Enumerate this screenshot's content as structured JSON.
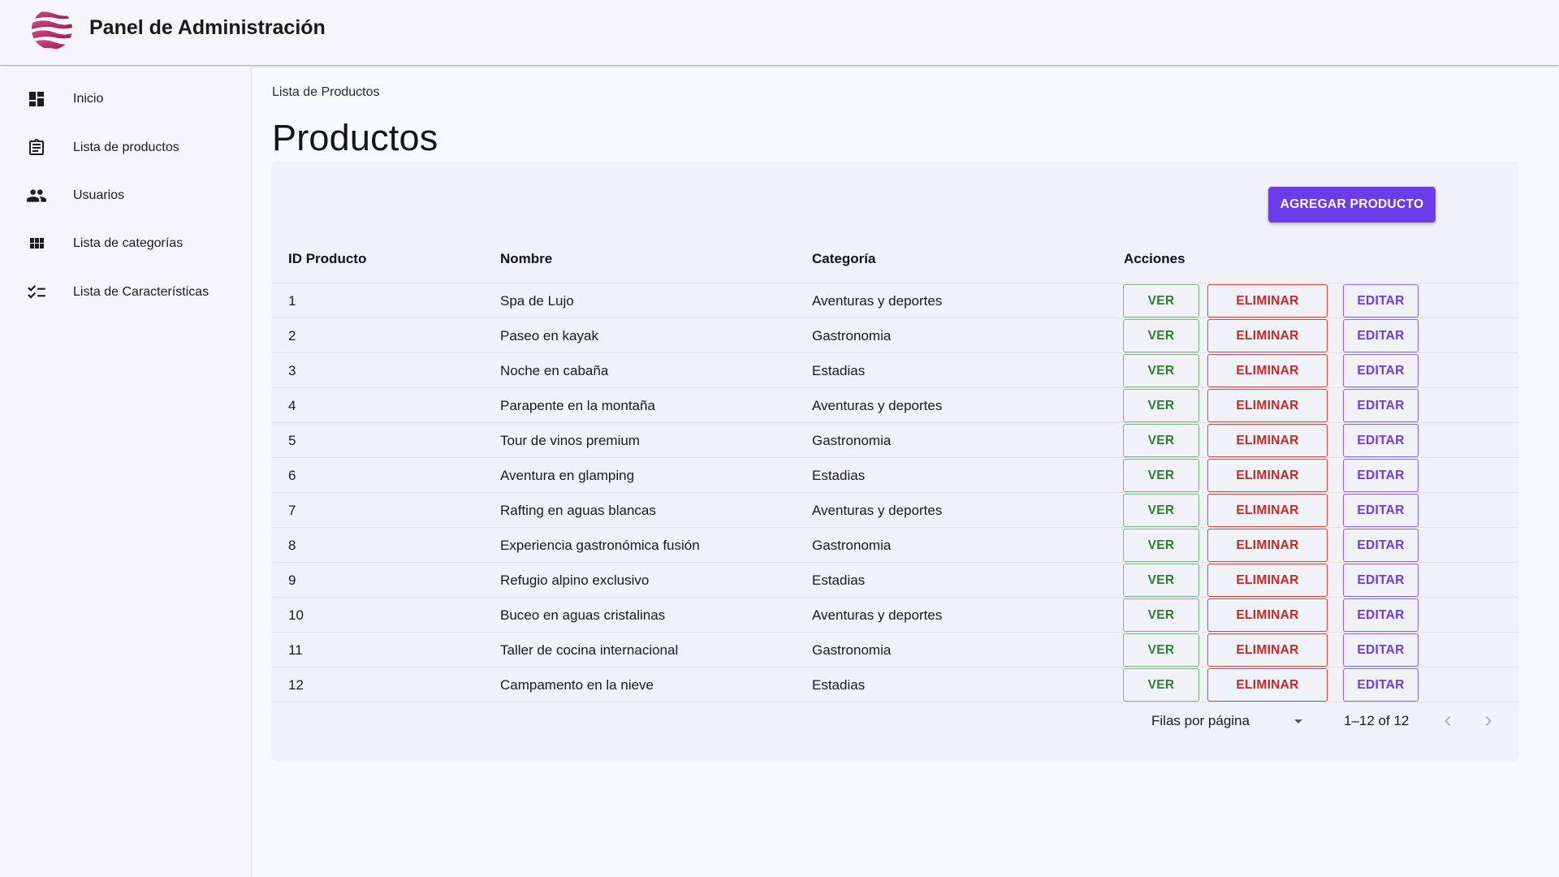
{
  "app": {
    "title": "Panel de Administración"
  },
  "sidebar": {
    "items": [
      {
        "label": "Inicio",
        "icon": "dashboard-icon"
      },
      {
        "label": "Lista de productos",
        "icon": "clipboard-list-icon"
      },
      {
        "label": "Usuarios",
        "icon": "people-icon"
      },
      {
        "label": "Lista de categorías",
        "icon": "grid-icon"
      },
      {
        "label": "Lista de Características",
        "icon": "checklist-icon"
      }
    ]
  },
  "main": {
    "breadcrumb": "Lista de Productos",
    "title": "Productos",
    "add_button": "AGREGAR PRODUCTO",
    "table": {
      "headers": [
        "ID Producto",
        "Nombre",
        "Categoría",
        "Acciones"
      ],
      "actions": {
        "view": "VER",
        "delete": "ELIMINAR",
        "edit": "EDITAR"
      },
      "rows": [
        {
          "id": "1",
          "name": "Spa de Lujo",
          "category": "Aventuras y deportes"
        },
        {
          "id": "2",
          "name": "Paseo en kayak",
          "category": "Gastronomia"
        },
        {
          "id": "3",
          "name": "Noche en cabaña",
          "category": "Estadias"
        },
        {
          "id": "4",
          "name": "Parapente en la montaña",
          "category": "Aventuras y deportes"
        },
        {
          "id": "5",
          "name": "Tour de vinos premium",
          "category": "Gastronomia"
        },
        {
          "id": "6",
          "name": "Aventura en glamping",
          "category": "Estadias"
        },
        {
          "id": "7",
          "name": "Rafting en aguas blancas",
          "category": "Aventuras y deportes"
        },
        {
          "id": "8",
          "name": "Experiencia gastronómica fusión",
          "category": "Gastronomia"
        },
        {
          "id": "9",
          "name": "Refugio alpino exclusivo",
          "category": "Estadias"
        },
        {
          "id": "10",
          "name": "Buceo en aguas cristalinas",
          "category": "Aventuras y deportes"
        },
        {
          "id": "11",
          "name": "Taller de cocina internacional",
          "category": "Gastronomia"
        },
        {
          "id": "12",
          "name": "Campamento en la nieve",
          "category": "Estadias"
        }
      ]
    },
    "pagination": {
      "rows_per_page_label": "Filas por página",
      "range": "1–12 of 12"
    }
  },
  "colors": {
    "primary": "#6a3de8",
    "view": "#2e7d32",
    "delete": "#c62828",
    "edit": "#6a3de8"
  }
}
